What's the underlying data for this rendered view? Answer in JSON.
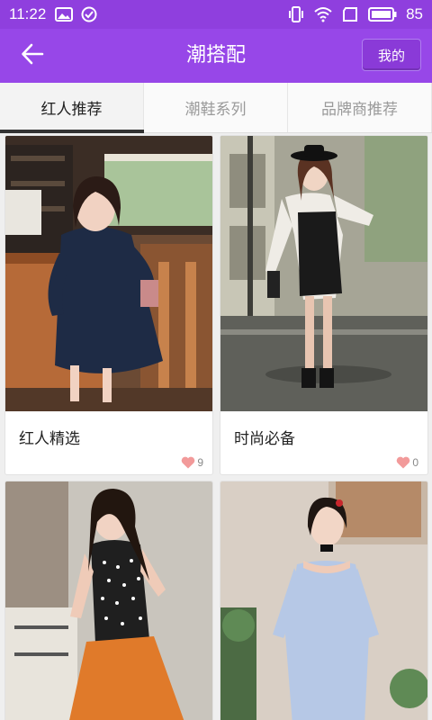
{
  "status_bar": {
    "time": "11:22",
    "battery": "85",
    "left_icons": [
      "image-icon",
      "check-circle-icon"
    ],
    "right_icons": [
      "vibrate-icon",
      "wifi-icon",
      "sim-icon",
      "battery-icon"
    ]
  },
  "app_bar": {
    "title": "潮搭配",
    "back_icon": "arrow-left-icon",
    "mine_label": "我的"
  },
  "tabs": [
    {
      "label": "红人推荐",
      "active": true
    },
    {
      "label": "潮鞋系列",
      "active": false
    },
    {
      "label": "品牌商推荐",
      "active": false
    }
  ],
  "cards": [
    {
      "title": "红人精选",
      "likes": "9"
    },
    {
      "title": "时尚必备",
      "likes": "0"
    },
    {
      "title": "",
      "likes": ""
    },
    {
      "title": "",
      "likes": ""
    }
  ],
  "colors": {
    "status_bar": "#8f3fde",
    "app_bar": "#9747e8",
    "heart": "#f29a9a"
  }
}
